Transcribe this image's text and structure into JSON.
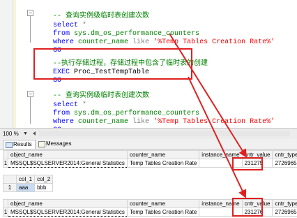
{
  "editor": {
    "lines": [
      {
        "text": "-- 查询实例级临时表创建次数"
      },
      {
        "keyword": "select",
        "rest": " *"
      },
      {
        "keyword": "from",
        "rest": " sys.dm_os_performance_counters"
      },
      {
        "keyword": "where",
        "rest": " counter_name ",
        "op": "like",
        "string": "'%Temp Tables Creation Rate%'"
      },
      {
        "keyword": "GO"
      },
      {
        "text": "--执行存储过程，存储过程中包含了临时表的创建"
      },
      {
        "keyword": "EXEC",
        "rest": " Proc_TestTempTable"
      },
      {
        "keyword": "GO"
      },
      {
        "text": "-- 查询实例级临时表创建次数"
      },
      {
        "keyword": "select",
        "rest": " *"
      },
      {
        "keyword": "from",
        "rest": " sys.dm_os_performance_counters"
      },
      {
        "keyword": "where",
        "rest": " counter_name ",
        "op": "like",
        "string": "'%Temp Tables Creation Rate%'"
      },
      {
        "keyword": "GO"
      }
    ]
  },
  "zoom": {
    "value": "100 %"
  },
  "tabs": [
    {
      "label": "Results",
      "active": true
    },
    {
      "label": "Messages",
      "active": false
    }
  ],
  "results": [
    {
      "columns": [
        "",
        "object_name",
        "counter_name",
        "instance_name",
        "cntr_value",
        "cntr_type"
      ],
      "rows": [
        [
          "1",
          "MSSQL$SQLSERVER2014:General Statistics",
          "Temp Tables Creation Rate",
          "",
          "231275",
          "272696576"
        ]
      ]
    },
    {
      "columns": [
        "",
        "col_1",
        "col_2"
      ],
      "rows": [
        [
          "1",
          "aaa",
          "bbb"
        ]
      ]
    },
    {
      "columns": [
        "",
        "object_name",
        "counter_name",
        "instance_name",
        "cntr_value",
        "cntr_type"
      ],
      "rows": [
        [
          "1",
          "MSSQL$SQLSERVER2014:General Statistics",
          "Temp Tables Creation Rate",
          "",
          "231276",
          "272696576"
        ]
      ]
    }
  ],
  "colors": {
    "highlight": "#e02020",
    "keyword": "#0000ff",
    "string": "#ff0000",
    "comment": "#008000"
  }
}
